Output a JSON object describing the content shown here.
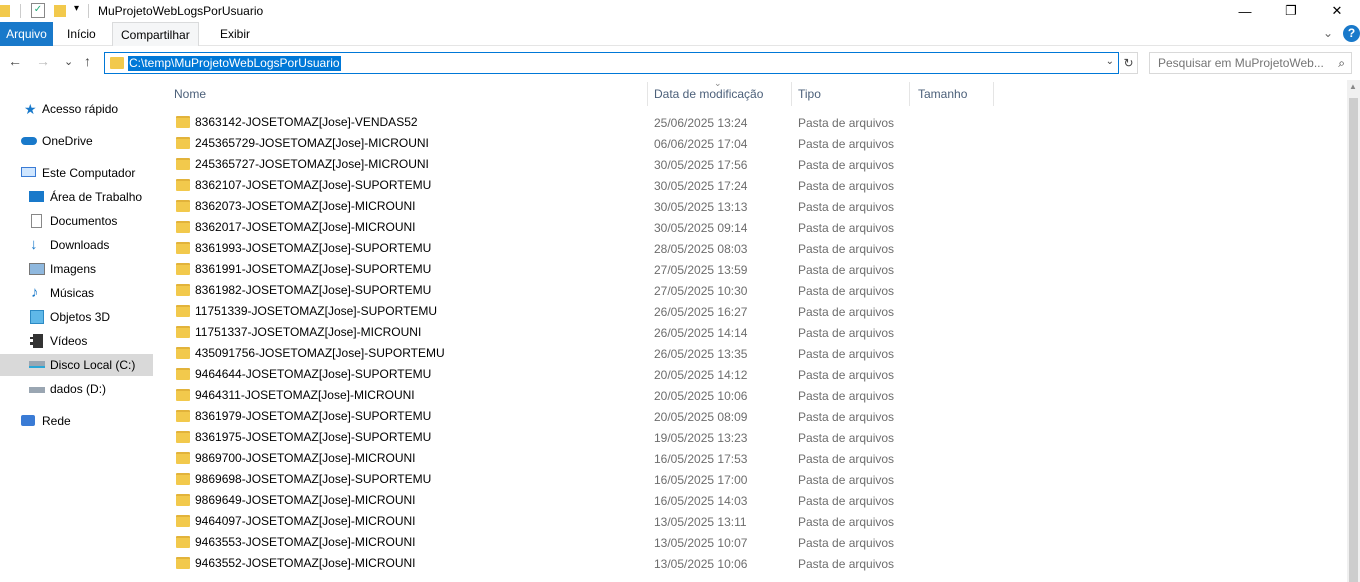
{
  "window": {
    "title": "MuProjetoWebLogsPorUsuario",
    "minimize": "—",
    "maximize": "❐",
    "close": "✕"
  },
  "ribbon": {
    "tabs": [
      "Arquivo",
      "Início",
      "Compartilhar",
      "Exibir"
    ],
    "active_tab": "Compartilhar",
    "expand": "⌄",
    "help": "?"
  },
  "nav": {
    "back": "←",
    "forward": "→",
    "recent": "⌄",
    "up": "↑",
    "address": "C:\\temp\\MuProjetoWebLogsPorUsuario",
    "refresh": "↻",
    "search_placeholder": "Pesquisar em MuProjetoWeb...",
    "search_icon": "⌕"
  },
  "sidebar": {
    "items": [
      {
        "label": "Acesso rápido",
        "icon": "star-icon"
      },
      {
        "label": "OneDrive",
        "icon": "cloud-icon"
      },
      {
        "label": "Este Computador",
        "icon": "computer-icon"
      },
      {
        "label": "Área de Trabalho",
        "icon": "desktop-icon"
      },
      {
        "label": "Documentos",
        "icon": "document-icon"
      },
      {
        "label": "Downloads",
        "icon": "download-icon"
      },
      {
        "label": "Imagens",
        "icon": "image-icon"
      },
      {
        "label": "Músicas",
        "icon": "music-icon"
      },
      {
        "label": "Objetos 3D",
        "icon": "cube-icon"
      },
      {
        "label": "Vídeos",
        "icon": "video-icon"
      },
      {
        "label": "Disco Local (C:)",
        "icon": "drive-icon",
        "selected": true
      },
      {
        "label": "dados (D:)",
        "icon": "drive-icon"
      },
      {
        "label": "Rede",
        "icon": "network-icon"
      }
    ]
  },
  "columns": {
    "name": "Nome",
    "date": "Data de modificação",
    "type": "Tipo",
    "size": "Tamanho"
  },
  "files": [
    {
      "name": "8363142-JOSETOMAZ[Jose]-VENDAS52",
      "date": "25/06/2025 13:24",
      "type": "Pasta de arquivos"
    },
    {
      "name": "245365729-JOSETOMAZ[Jose]-MICROUNI",
      "date": "06/06/2025 17:04",
      "type": "Pasta de arquivos"
    },
    {
      "name": "245365727-JOSETOMAZ[Jose]-MICROUNI",
      "date": "30/05/2025 17:56",
      "type": "Pasta de arquivos"
    },
    {
      "name": "8362107-JOSETOMAZ[Jose]-SUPORTEMU",
      "date": "30/05/2025 17:24",
      "type": "Pasta de arquivos"
    },
    {
      "name": "8362073-JOSETOMAZ[Jose]-MICROUNI",
      "date": "30/05/2025 13:13",
      "type": "Pasta de arquivos"
    },
    {
      "name": "8362017-JOSETOMAZ[Jose]-MICROUNI",
      "date": "30/05/2025 09:14",
      "type": "Pasta de arquivos"
    },
    {
      "name": "8361993-JOSETOMAZ[Jose]-SUPORTEMU",
      "date": "28/05/2025 08:03",
      "type": "Pasta de arquivos"
    },
    {
      "name": "8361991-JOSETOMAZ[Jose]-SUPORTEMU",
      "date": "27/05/2025 13:59",
      "type": "Pasta de arquivos"
    },
    {
      "name": "8361982-JOSETOMAZ[Jose]-SUPORTEMU",
      "date": "27/05/2025 10:30",
      "type": "Pasta de arquivos"
    },
    {
      "name": "11751339-JOSETOMAZ[Jose]-SUPORTEMU",
      "date": "26/05/2025 16:27",
      "type": "Pasta de arquivos"
    },
    {
      "name": "11751337-JOSETOMAZ[Jose]-MICROUNI",
      "date": "26/05/2025 14:14",
      "type": "Pasta de arquivos"
    },
    {
      "name": "435091756-JOSETOMAZ[Jose]-SUPORTEMU",
      "date": "26/05/2025 13:35",
      "type": "Pasta de arquivos"
    },
    {
      "name": "9464644-JOSETOMAZ[Jose]-SUPORTEMU",
      "date": "20/05/2025 14:12",
      "type": "Pasta de arquivos"
    },
    {
      "name": "9464311-JOSETOMAZ[Jose]-MICROUNI",
      "date": "20/05/2025 10:06",
      "type": "Pasta de arquivos"
    },
    {
      "name": "8361979-JOSETOMAZ[Jose]-SUPORTEMU",
      "date": "20/05/2025 08:09",
      "type": "Pasta de arquivos"
    },
    {
      "name": "8361975-JOSETOMAZ[Jose]-SUPORTEMU",
      "date": "19/05/2025 13:23",
      "type": "Pasta de arquivos"
    },
    {
      "name": "9869700-JOSETOMAZ[Jose]-MICROUNI",
      "date": "16/05/2025 17:53",
      "type": "Pasta de arquivos"
    },
    {
      "name": "9869698-JOSETOMAZ[Jose]-SUPORTEMU",
      "date": "16/05/2025 17:00",
      "type": "Pasta de arquivos"
    },
    {
      "name": "9869649-JOSETOMAZ[Jose]-MICROUNI",
      "date": "16/05/2025 14:03",
      "type": "Pasta de arquivos"
    },
    {
      "name": "9464097-JOSETOMAZ[Jose]-MICROUNI",
      "date": "13/05/2025 13:11",
      "type": "Pasta de arquivos"
    },
    {
      "name": "9463553-JOSETOMAZ[Jose]-MICROUNI",
      "date": "13/05/2025 10:07",
      "type": "Pasta de arquivos"
    },
    {
      "name": "9463552-JOSETOMAZ[Jose]-MICROUNI",
      "date": "13/05/2025 10:06",
      "type": "Pasta de arquivos"
    }
  ],
  "colors": {
    "accent": "#0078d7",
    "file_tab": "#1979ca",
    "folder": "#f2c94c",
    "selected": "#d9d9d9"
  }
}
